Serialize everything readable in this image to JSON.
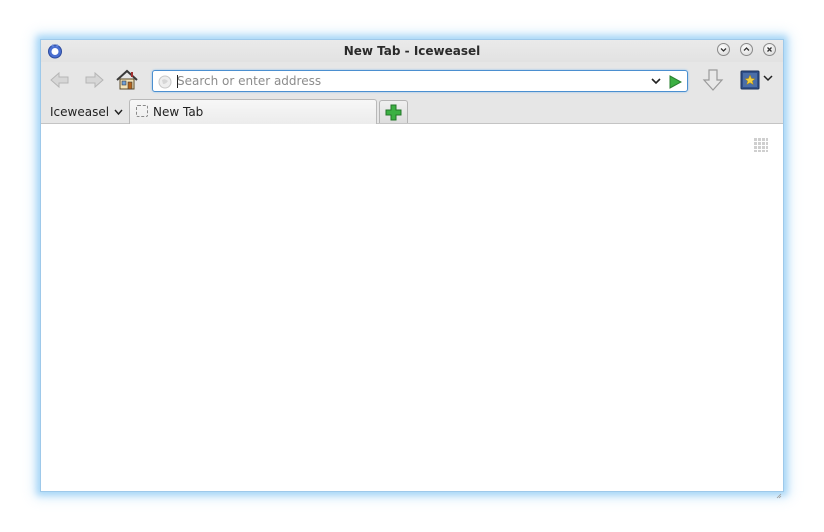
{
  "window": {
    "title": "New Tab - Iceweasel",
    "controls": [
      "minimize",
      "maximize",
      "close"
    ]
  },
  "toolbar": {
    "back_icon": "back-arrow-icon",
    "forward_icon": "forward-arrow-icon",
    "home_icon": "home-icon",
    "url": {
      "value": "",
      "placeholder": "Search or enter address",
      "globe_icon": "globe-icon",
      "dropdown_icon": "chevron-down-icon",
      "go_icon": "go-arrow-icon"
    },
    "download_icon": "download-arrow-icon",
    "bookmarks_icon": "bookmarks-star-icon"
  },
  "tabstrip": {
    "app_menu_label": "Iceweasel",
    "tabs": [
      {
        "label": "New Tab"
      }
    ],
    "new_tab_icon": "plus-icon"
  },
  "content": {
    "grid_toggle_icon": "grid-icon"
  },
  "colors": {
    "accent_border": "#4b8fd0",
    "window_glow": "#a9d8f7",
    "go_green": "#3cb043"
  }
}
